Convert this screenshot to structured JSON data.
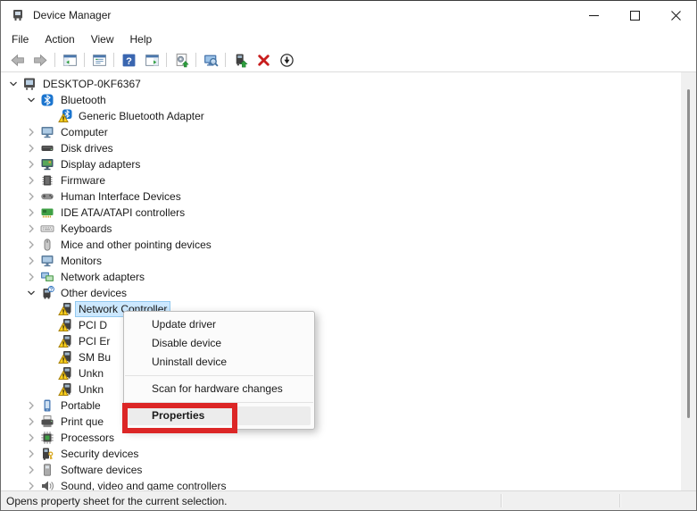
{
  "window": {
    "title": "Device Manager",
    "controls": [
      "minimize-icon",
      "maximize-icon",
      "close-icon"
    ]
  },
  "menubar": {
    "items": [
      {
        "label": "File"
      },
      {
        "label": "Action"
      },
      {
        "label": "View"
      },
      {
        "label": "Help"
      }
    ]
  },
  "toolbar": {
    "buttons": [
      {
        "icon": "back-arrow-icon"
      },
      {
        "icon": "forward-arrow-icon"
      },
      {
        "icon": "show-console-tree-icon"
      },
      {
        "icon": "properties-list-icon"
      },
      {
        "icon": "help-icon"
      },
      {
        "icon": "show-action-pane-icon"
      },
      {
        "icon": "update-driver-icon"
      },
      {
        "icon": "scan-hardware-changes-icon"
      },
      {
        "icon": "update-device-drivers-icon"
      },
      {
        "icon": "uninstall-device-icon"
      },
      {
        "icon": "disable-device-icon"
      }
    ]
  },
  "tree": {
    "items": [
      {
        "label": "DESKTOP-0KF6367",
        "level": 0,
        "state": "expanded",
        "icon": "computer-icon"
      },
      {
        "label": "Bluetooth",
        "level": 1,
        "state": "expanded",
        "icon": "bluetooth-icon"
      },
      {
        "label": "Generic Bluetooth Adapter",
        "level": 2,
        "state": "leaf",
        "icon": "bluetooth-warning-icon"
      },
      {
        "label": "Computer",
        "level": 1,
        "state": "collapsed",
        "icon": "monitor-icon"
      },
      {
        "label": "Disk drives",
        "level": 1,
        "state": "collapsed",
        "icon": "disk-drive-icon"
      },
      {
        "label": "Display adapters",
        "level": 1,
        "state": "collapsed",
        "icon": "display-adapter-icon"
      },
      {
        "label": "Firmware",
        "level": 1,
        "state": "collapsed",
        "icon": "firmware-icon"
      },
      {
        "label": "Human Interface Devices",
        "level": 1,
        "state": "collapsed",
        "icon": "hid-icon"
      },
      {
        "label": "IDE ATA/ATAPI controllers",
        "level": 1,
        "state": "collapsed",
        "icon": "ide-controller-icon"
      },
      {
        "label": "Keyboards",
        "level": 1,
        "state": "collapsed",
        "icon": "keyboard-icon"
      },
      {
        "label": "Mice and other pointing devices",
        "level": 1,
        "state": "collapsed",
        "icon": "mouse-icon"
      },
      {
        "label": "Monitors",
        "level": 1,
        "state": "collapsed",
        "icon": "monitor-icon"
      },
      {
        "label": "Network adapters",
        "level": 1,
        "state": "collapsed",
        "icon": "network-adapter-icon"
      },
      {
        "label": "Other devices",
        "level": 1,
        "state": "expanded",
        "icon": "unknown-device-category-icon"
      },
      {
        "label": "Network Controller",
        "level": 2,
        "state": "leaf",
        "icon": "device-warning-icon",
        "selected": true
      },
      {
        "label": "PCI D",
        "level": 2,
        "state": "leaf",
        "icon": "device-warning-icon",
        "truncated_by_menu": true
      },
      {
        "label": "PCI Er",
        "level": 2,
        "state": "leaf",
        "icon": "device-warning-icon",
        "truncated_by_menu": true
      },
      {
        "label": "SM Bu",
        "level": 2,
        "state": "leaf",
        "icon": "device-warning-icon",
        "truncated_by_menu": true
      },
      {
        "label": "Unkn",
        "level": 2,
        "state": "leaf",
        "icon": "device-warning-icon",
        "truncated_by_menu": true
      },
      {
        "label": "Unkn",
        "level": 2,
        "state": "leaf",
        "icon": "device-warning-icon",
        "truncated_by_menu": true
      },
      {
        "label": "Portable",
        "level": 1,
        "state": "collapsed",
        "icon": "portable-device-icon",
        "truncated_by_menu": true
      },
      {
        "label": "Print que",
        "level": 1,
        "state": "collapsed",
        "icon": "printer-icon",
        "truncated_by_menu": true
      },
      {
        "label": "Processors",
        "level": 1,
        "state": "collapsed",
        "icon": "processor-icon"
      },
      {
        "label": "Security devices",
        "level": 1,
        "state": "collapsed",
        "icon": "security-device-icon"
      },
      {
        "label": "Software devices",
        "level": 1,
        "state": "collapsed",
        "icon": "software-device-icon"
      },
      {
        "label": "Sound, video and game controllers",
        "level": 1,
        "state": "collapsed",
        "icon": "sound-icon"
      }
    ]
  },
  "context_menu": {
    "items": [
      {
        "type": "item",
        "label": "Update driver"
      },
      {
        "type": "item",
        "label": "Disable device"
      },
      {
        "type": "item",
        "label": "Uninstall device"
      },
      {
        "type": "separator"
      },
      {
        "type": "item",
        "label": "Scan for hardware changes"
      },
      {
        "type": "separator"
      },
      {
        "type": "item",
        "label": "Properties",
        "highlighted": true,
        "bold": true
      }
    ]
  },
  "annotation": {
    "shape": "red-rectangle",
    "target": "Properties",
    "color": "#dc2626"
  },
  "statusbar": {
    "text": "Opens property sheet for the current selection."
  },
  "colors": {
    "selection_bg": "#cce8ff",
    "selection_border": "#93c9ef",
    "annotation_red": "#dc2626",
    "warning_yellow": "#ffd21e",
    "bluetooth_blue": "#1b75cf",
    "help_blue": "#3a66b0",
    "statusbar_bg": "#f0f0f0"
  }
}
